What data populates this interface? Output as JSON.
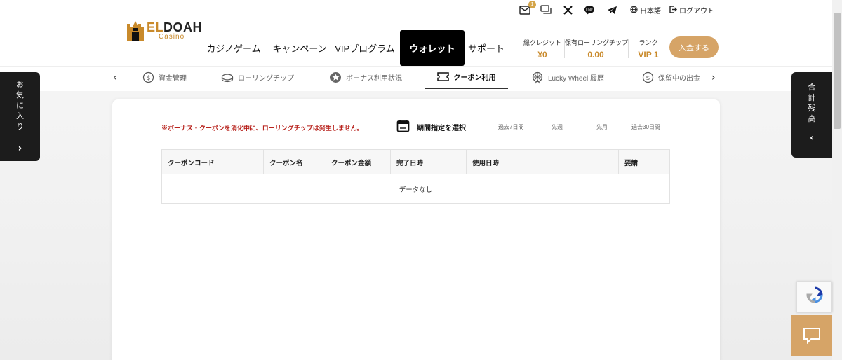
{
  "utility": {
    "mail_badge": "1",
    "language_label": "日本語",
    "logout_label": "ログアウト"
  },
  "brand": {
    "name_part1": "EL",
    "name_part2": "DOAH",
    "sub": "Casino"
  },
  "nav": {
    "items": [
      "カジノゲーム",
      "キャンペーン",
      "VIPプログラム",
      "ウォレット",
      "サポート"
    ],
    "active_index": 3
  },
  "stats": [
    {
      "label": "総クレジット",
      "value": "¥0"
    },
    {
      "label": "保有ローリングチップ",
      "value": "0.00"
    },
    {
      "label": "ランク",
      "value": "VIP 1"
    }
  ],
  "deposit_label": "入金する",
  "subtabs": {
    "items": [
      {
        "label": "資金管理",
        "icon": "money-circle-icon"
      },
      {
        "label": "ローリングチップ",
        "icon": "chip-icon"
      },
      {
        "label": "ボーナス利用状況",
        "icon": "star-badge-icon"
      },
      {
        "label": "クーポン利用",
        "icon": "ticket-icon"
      },
      {
        "label": "Lucky Wheel 履歴",
        "icon": "wheel-icon"
      },
      {
        "label": "保留中の出金",
        "icon": "coin-icon"
      }
    ],
    "active_index": 3
  },
  "side_left": {
    "text": [
      "お",
      "気",
      "に",
      "入",
      "り"
    ]
  },
  "side_right": {
    "text": [
      "合",
      "計",
      "残",
      "高"
    ]
  },
  "notice": "※ボーナス・クーポンを消化中に、ローリングチップは発生しません。",
  "date_picker_label": "期間指定を選択",
  "periods": [
    "過去7日間",
    "先週",
    "先月",
    "過去30日間"
  ],
  "table": {
    "columns": [
      "クーポンコード",
      "クーポン名",
      "クーポン金額",
      "完了日時",
      "使用日時",
      "要請"
    ],
    "empty_text": "データなし"
  },
  "colors": {
    "accent_gold": "#c98a2b",
    "button_gold": "#d6a467",
    "notice_red": "#b8231d",
    "dark_panel": "#1c1c1c"
  }
}
